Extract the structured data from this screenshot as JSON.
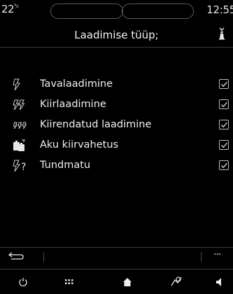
{
  "status_bar": {
    "temperature": "22",
    "temperature_unit": "°c",
    "time": "12:55"
  },
  "header": {
    "title": "Laadimise tüüp;"
  },
  "list": {
    "items": [
      {
        "label": "Tavalaadimine",
        "icon": "bolt-icon",
        "checked": true
      },
      {
        "label": "Kiirlaadimine",
        "icon": "double-bolt-icon",
        "checked": true
      },
      {
        "label": "Kiirendatud laadimine",
        "icon": "triple-bolt-icon",
        "checked": true
      },
      {
        "label": "Aku kiirvahetus",
        "icon": "battery-swap-icon",
        "checked": true
      },
      {
        "label": "Tundmatu",
        "icon": "bolt-question-icon",
        "checked": true
      }
    ]
  },
  "toolbar": {
    "more_label": "···"
  },
  "icons": {
    "back": "back-arrow-icon",
    "power": "power-icon",
    "apps": "apps-grid-icon",
    "home": "home-icon",
    "nav": "navigation-icon",
    "volume": "volume-icon",
    "header": "person-seat-icon"
  },
  "colors": {
    "background": "#000000",
    "text": "#f0f0f0",
    "divider": "#3a3a3a",
    "checkbox": "#bdbdbd"
  }
}
